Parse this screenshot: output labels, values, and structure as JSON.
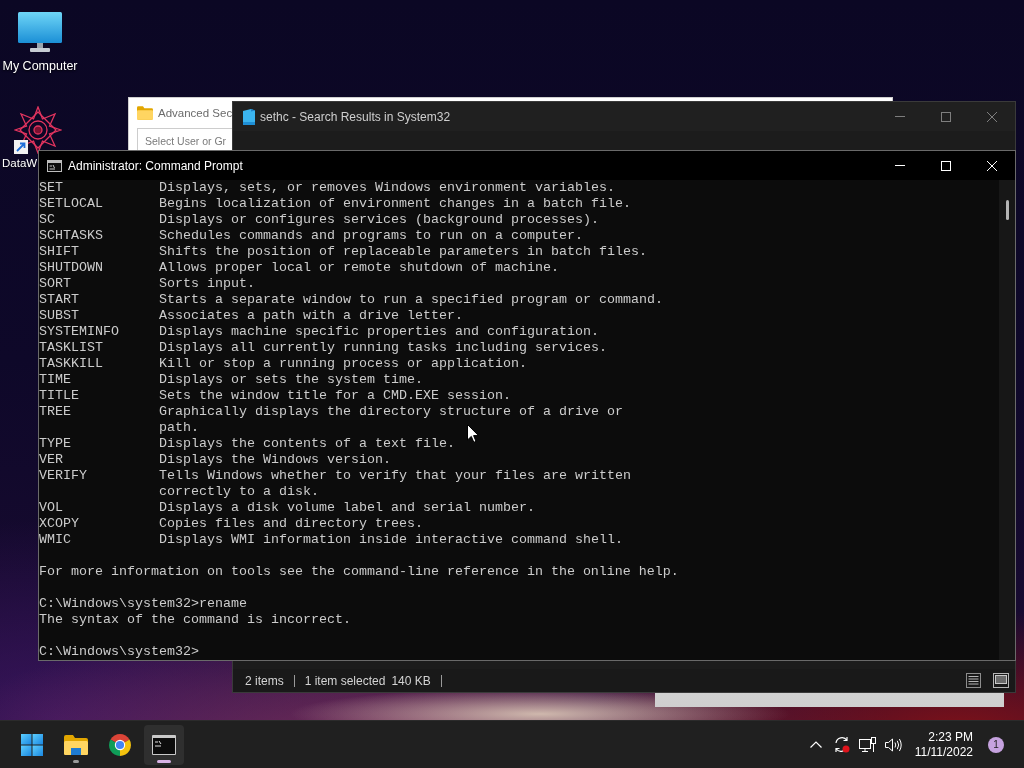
{
  "desktop": {
    "icons": [
      {
        "label": "My Computer",
        "kind": "computer"
      },
      {
        "label": "DataW",
        "kind": "shortcut"
      }
    ]
  },
  "advanced_window": {
    "title": "Advanced Sec",
    "active": false,
    "field": {
      "placeholder": "Select User or Gr"
    }
  },
  "explorer_window": {
    "title": "sethc - Search Results in System32",
    "active": false,
    "status_bar": {
      "item_count": "2 items",
      "selection": "1 item selected",
      "size": "140 KB"
    }
  },
  "command_prompt": {
    "title": "Administrator: Command Prompt",
    "active": true,
    "help_entries": [
      {
        "command": "SET",
        "description": [
          "Displays, sets, or removes Windows environment variables."
        ]
      },
      {
        "command": "SETLOCAL",
        "description": [
          "Begins localization of environment changes in a batch file."
        ]
      },
      {
        "command": "SC",
        "description": [
          "Displays or configures services (background processes)."
        ]
      },
      {
        "command": "SCHTASKS",
        "description": [
          "Schedules commands and programs to run on a computer."
        ]
      },
      {
        "command": "SHIFT",
        "description": [
          "Shifts the position of replaceable parameters in batch files."
        ]
      },
      {
        "command": "SHUTDOWN",
        "description": [
          "Allows proper local or remote shutdown of machine."
        ]
      },
      {
        "command": "SORT",
        "description": [
          "Sorts input."
        ]
      },
      {
        "command": "START",
        "description": [
          "Starts a separate window to run a specified program or command."
        ]
      },
      {
        "command": "SUBST",
        "description": [
          "Associates a path with a drive letter."
        ]
      },
      {
        "command": "SYSTEMINFO",
        "description": [
          "Displays machine specific properties and configuration."
        ]
      },
      {
        "command": "TASKLIST",
        "description": [
          "Displays all currently running tasks including services."
        ]
      },
      {
        "command": "TASKKILL",
        "description": [
          "Kill or stop a running process or application."
        ]
      },
      {
        "command": "TIME",
        "description": [
          "Displays or sets the system time."
        ]
      },
      {
        "command": "TITLE",
        "description": [
          "Sets the window title for a CMD.EXE session."
        ]
      },
      {
        "command": "TREE",
        "description": [
          "Graphically displays the directory structure of a drive or",
          "path."
        ]
      },
      {
        "command": "TYPE",
        "description": [
          "Displays the contents of a text file."
        ]
      },
      {
        "command": "VER",
        "description": [
          "Displays the Windows version."
        ]
      },
      {
        "command": "VERIFY",
        "description": [
          "Tells Windows whether to verify that your files are written",
          "correctly to a disk."
        ]
      },
      {
        "command": "VOL",
        "description": [
          "Displays a disk volume label and serial number."
        ]
      },
      {
        "command": "XCOPY",
        "description": [
          "Copies files and directory trees."
        ]
      },
      {
        "command": "WMIC",
        "description": [
          "Displays WMI information inside interactive command shell."
        ]
      }
    ],
    "output_blocks": [
      [
        "For more information on tools see the command-line reference in the online help."
      ],
      [
        "C:\\Windows\\system32>rename",
        "The syntax of the command is incorrect."
      ],
      [
        "C:\\Windows\\system32>"
      ]
    ]
  },
  "taskbar": {
    "apps": [
      {
        "kind": "explorer",
        "running": true,
        "selected": false
      },
      {
        "kind": "browser",
        "running": false,
        "selected": false
      },
      {
        "kind": "terminal",
        "running": true,
        "selected": true
      }
    ],
    "clock": {
      "time": "2:23 PM",
      "date": "11/11/2022"
    },
    "notification_count": "1"
  }
}
